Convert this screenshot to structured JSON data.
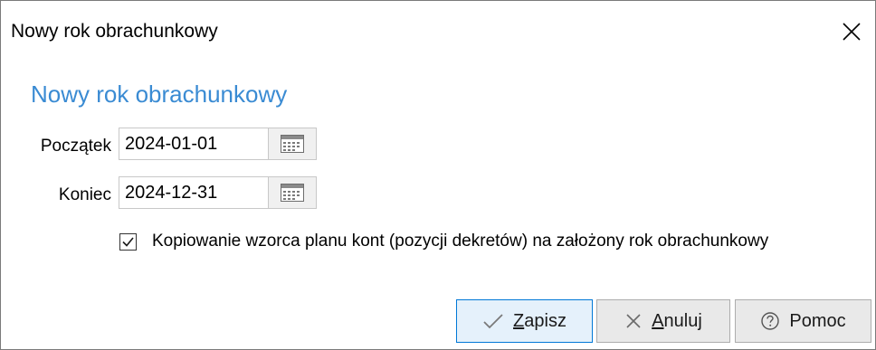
{
  "window": {
    "title": "Nowy rok obrachunkowy"
  },
  "form": {
    "heading": "Nowy rok obrachunkowy",
    "start": {
      "label": "Początek",
      "value": "2024-01-01"
    },
    "end": {
      "label": "Koniec",
      "value": "2024-12-31"
    },
    "copy_template": {
      "checked": true,
      "label": "Kopiowanie wzorca planu kont (pozycji dekretów) na założony rok obrachunkowy"
    }
  },
  "buttons": {
    "save": {
      "accel": "Z",
      "rest": "apisz",
      "icon": "checkmark-icon"
    },
    "cancel": {
      "accel": "A",
      "rest": "nuluj",
      "icon": "x-icon"
    },
    "help": {
      "label": "Pomoc",
      "icon": "question-circle-icon"
    }
  },
  "colors": {
    "heading": "#3a8bd3",
    "primary_border": "#0078d7",
    "primary_bg": "#e5f1fb",
    "button_bg": "#e9e9e9"
  }
}
